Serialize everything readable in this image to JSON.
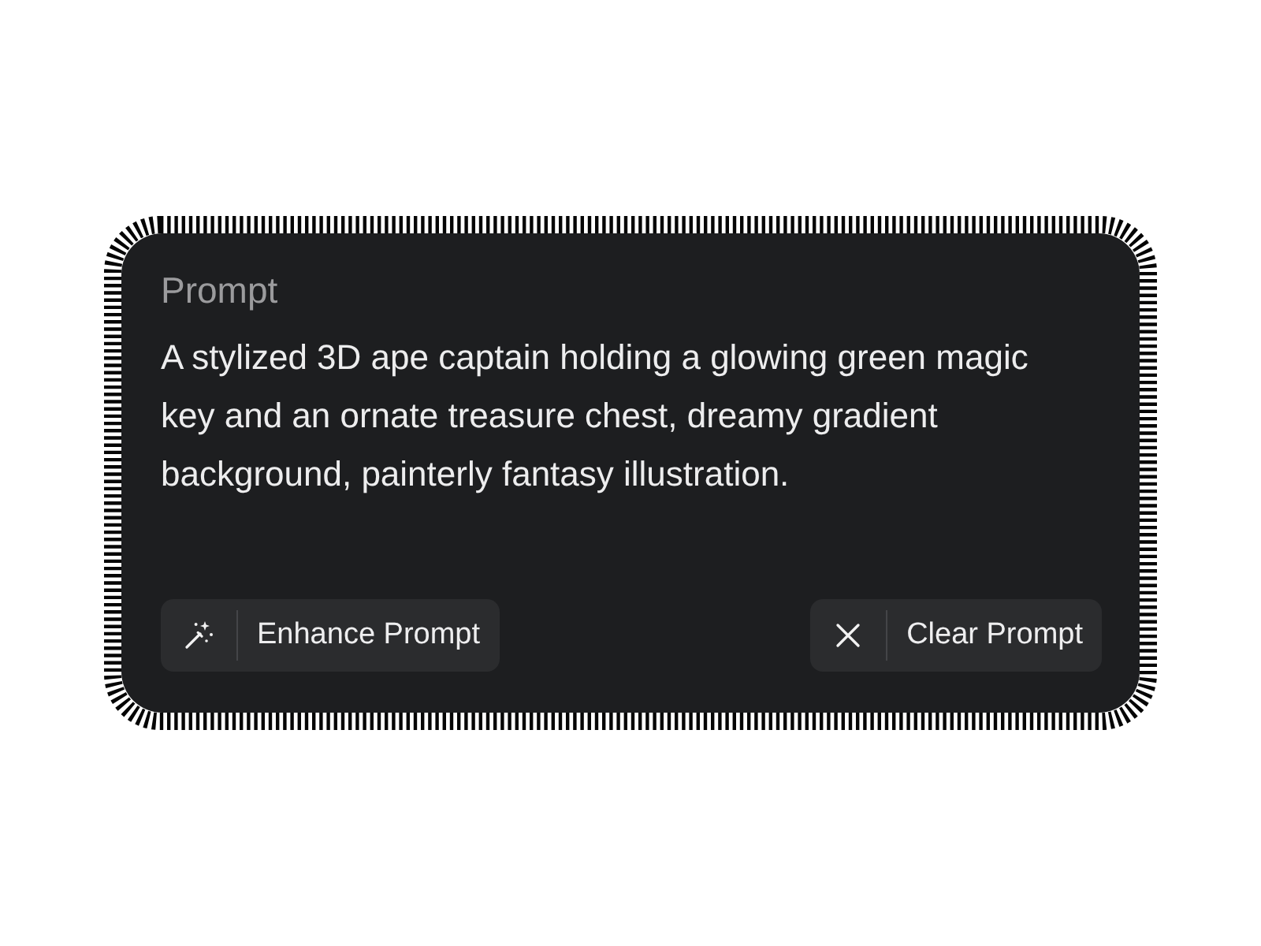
{
  "prompt": {
    "label": "Prompt",
    "text": "A stylized 3D ape captain holding a glowing green magic key and an ornate treasure chest, dreamy gradient background, painterly fantasy illustration."
  },
  "actions": [
    {
      "kind": "enhance",
      "label": "Enhance Prompt"
    },
    {
      "kind": "clear",
      "label": "Clear Prompt"
    }
  ]
}
